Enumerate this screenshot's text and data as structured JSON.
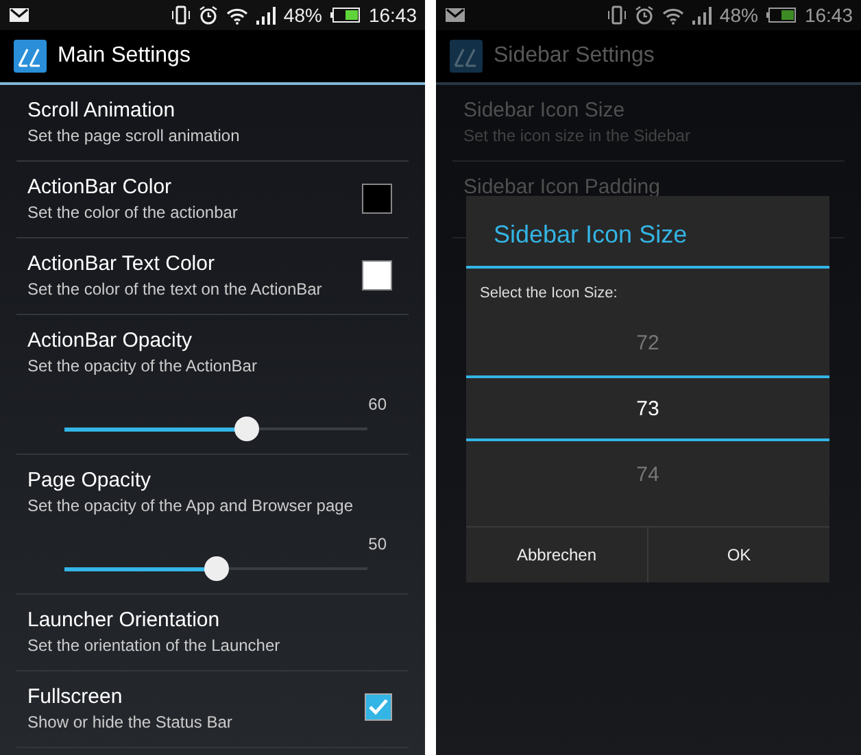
{
  "screens": [
    {
      "status_bar": {
        "battery": "48%",
        "time": "16:43"
      },
      "title": "Main Settings",
      "dimmed": false,
      "items": [
        {
          "kind": "plain",
          "title": "Scroll Animation",
          "subtitle": "Set the page scroll animation"
        },
        {
          "kind": "color",
          "title": "ActionBar Color",
          "subtitle": "Set the color of the actionbar",
          "color": "#000000"
        },
        {
          "kind": "color",
          "title": "ActionBar Text Color",
          "subtitle": "Set the color of the text on the ActionBar",
          "color": "#ffffff"
        },
        {
          "kind": "slider",
          "title": "ActionBar Opacity",
          "subtitle": "Set the opacity of the ActionBar",
          "reading": "60",
          "level": 0.6
        },
        {
          "kind": "slider",
          "title": "Page Opacity",
          "subtitle": "Set the opacity of the App and Browser page",
          "reading": "50",
          "level": 0.5
        },
        {
          "kind": "plain",
          "title": "Launcher Orientation",
          "subtitle": "Set the orientation of the Launcher"
        },
        {
          "kind": "checkbox",
          "title": "Fullscreen",
          "subtitle": "Show or hide the Status Bar",
          "checked": true
        }
      ]
    },
    {
      "status_bar": {
        "battery": "48%",
        "time": "16:43"
      },
      "title": "Sidebar Settings",
      "dimmed": true,
      "items": [
        {
          "kind": "plain",
          "title": "Sidebar Icon Size",
          "subtitle": "Set the icon size in the Sidebar"
        },
        {
          "kind": "plain",
          "title": "Sidebar Icon Padding"
        }
      ],
      "dialog": {
        "title": "Sidebar Icon Size",
        "label": "Select the Icon Size:",
        "options": [
          {
            "label": "72",
            "selected": false
          },
          {
            "label": "73",
            "selected": true
          },
          {
            "label": "74",
            "selected": false
          }
        ],
        "buttons": [
          "Abbrechen",
          "OK"
        ]
      }
    }
  ]
}
